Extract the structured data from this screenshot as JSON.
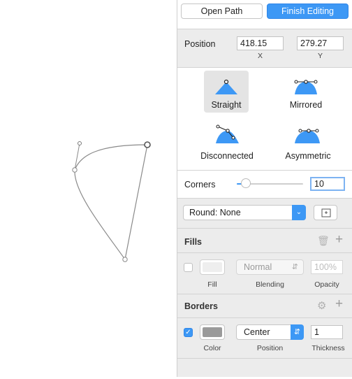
{
  "top_buttons": {
    "open_path": "Open Path",
    "finish_editing": "Finish Editing"
  },
  "position": {
    "label": "Position",
    "x_value": "418.15",
    "y_value": "279.27",
    "x_caption": "X",
    "y_caption": "Y"
  },
  "point_types": [
    {
      "label": "Straight",
      "icon": "straight-point-icon",
      "selected": true
    },
    {
      "label": "Mirrored",
      "icon": "mirrored-point-icon",
      "selected": false
    },
    {
      "label": "Disconnected",
      "icon": "disconnected-point-icon",
      "selected": false
    },
    {
      "label": "Asymmetric",
      "icon": "asymmetric-point-icon",
      "selected": false
    }
  ],
  "corners": {
    "label": "Corners",
    "value": "10",
    "slider_fraction": 0.12
  },
  "round": {
    "selected": "Round: None"
  },
  "fills": {
    "title": "Fills",
    "blending": "Normal",
    "opacity_placeholder": "100%",
    "captions": {
      "fill": "Fill",
      "blending": "Blending",
      "opacity": "Opacity"
    }
  },
  "borders": {
    "title": "Borders",
    "position": "Center",
    "thickness": "1",
    "captions": {
      "color": "Color",
      "position": "Position",
      "thickness": "Thickness"
    }
  },
  "colors": {
    "accent": "#3d98f5",
    "border_swatch": "#9a9a9a",
    "fill_swatch": "#eeeeee"
  }
}
